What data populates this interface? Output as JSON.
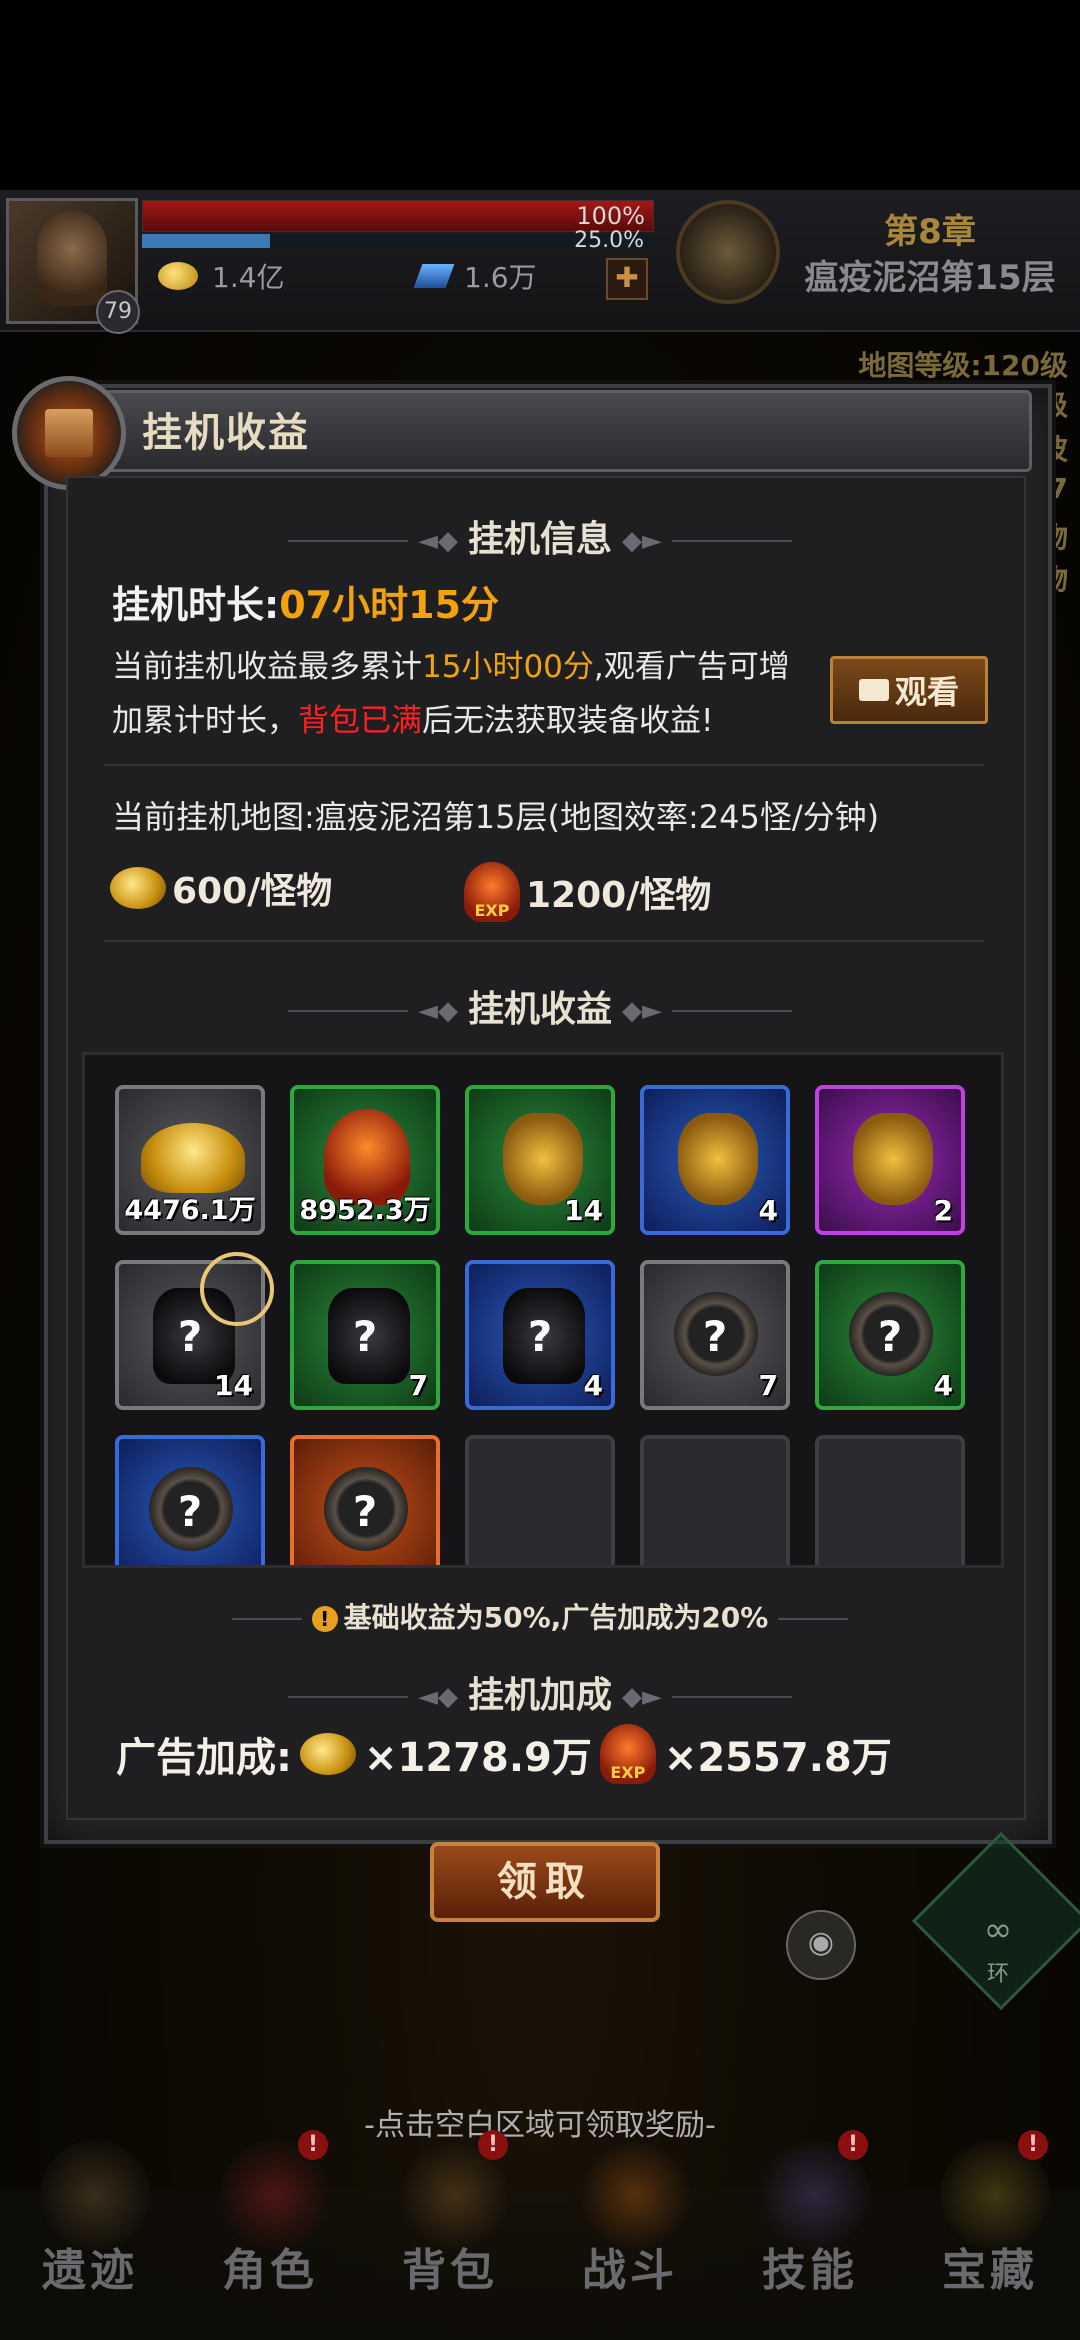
{
  "hud": {
    "level": "79",
    "hp_percent": "100%",
    "xp_percent": "25.0%",
    "hp_fill": 1.0,
    "xp_fill": 0.25,
    "gold": "1.4亿",
    "gems": "1.6万",
    "chapter": "第8章",
    "stage": "瘟疫泥沼第15层",
    "map_level": "地图等级:120级",
    "side_fragments": [
      "级",
      "波",
      "57",
      "物",
      "物"
    ]
  },
  "dialog": {
    "title": "挂机收益",
    "info_section": "挂机信息",
    "idle_time_label": "挂机时长:",
    "idle_time_value": "07小时15分",
    "desc_part1": "当前挂机收益最多累计",
    "desc_max": "15小时00分",
    "desc_part2": ",观看广告可增加累计时长，",
    "desc_full": "背包已满",
    "desc_part3": "后无法获取装备收益!",
    "watch_label": "观看",
    "map_info": "当前挂机地图:瘟疫泥沼第15层(地图效率:245怪/分钟)",
    "gold_rate": "600/怪物",
    "exp_rate": "1200/怪物",
    "rewards_section": "挂机收益",
    "rewards": [
      {
        "type": "gold",
        "rarity": "gray",
        "count": "4476.1万"
      },
      {
        "type": "exp",
        "rarity": "green",
        "count": "8952.3万"
      },
      {
        "type": "bag",
        "rarity": "green",
        "count": "14"
      },
      {
        "type": "bag",
        "rarity": "blue",
        "count": "4"
      },
      {
        "type": "bag",
        "rarity": "purple",
        "count": "2"
      },
      {
        "type": "armor",
        "rarity": "gray",
        "count": "14"
      },
      {
        "type": "armor",
        "rarity": "green",
        "count": "7"
      },
      {
        "type": "armor",
        "rarity": "blue",
        "count": "4"
      },
      {
        "type": "ring",
        "rarity": "gray",
        "count": "7"
      },
      {
        "type": "ring",
        "rarity": "green",
        "count": "4"
      },
      {
        "type": "ring",
        "rarity": "blue",
        "count": ""
      },
      {
        "type": "ring",
        "rarity": "orange",
        "count": ""
      },
      {
        "type": "empty",
        "rarity": "empty",
        "count": ""
      },
      {
        "type": "empty",
        "rarity": "empty",
        "count": ""
      },
      {
        "type": "empty",
        "rarity": "empty",
        "count": ""
      }
    ],
    "notice": "基础收益为50%,广告加成为20%",
    "bonus_section": "挂机加成",
    "bonus_label": "广告加成:",
    "bonus_gold": "×1278.9万",
    "bonus_exp": "×2557.8万",
    "claim_label": "领取",
    "exp_tag": "EXP"
  },
  "scene": {
    "ring_symbol": "∞",
    "ring_label": "环",
    "tap_hint": "-点击空白区域可领取奖励-"
  },
  "nav": [
    {
      "label": "遗迹",
      "badge": ""
    },
    {
      "label": "角色",
      "badge": "!"
    },
    {
      "label": "背包",
      "badge": "!"
    },
    {
      "label": "战斗",
      "badge": ""
    },
    {
      "label": "技能",
      "badge": "!"
    },
    {
      "label": "宝藏",
      "badge": "!"
    }
  ],
  "colors": {
    "highlight_orange": "#f2a20f",
    "warning_red": "#ff2020",
    "text_light": "#e8e8e8"
  }
}
